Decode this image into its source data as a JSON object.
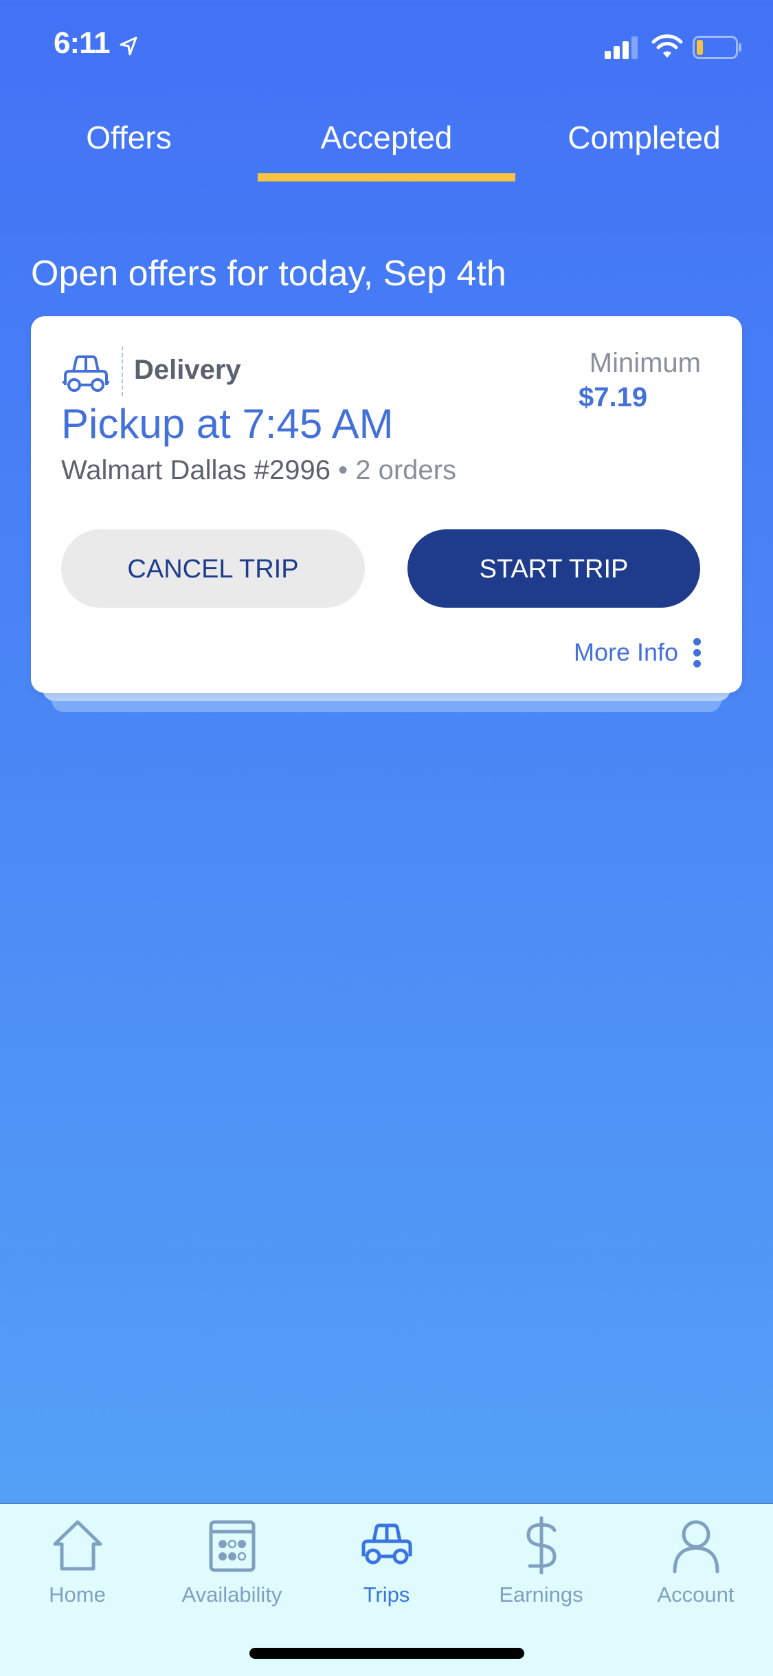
{
  "status_bar": {
    "time": "6:11",
    "icons": [
      "location-arrow-icon",
      "signal-icon",
      "wifi-icon",
      "battery-low-icon"
    ],
    "battery_color": "#F5C242"
  },
  "tabs": [
    {
      "label": "Offers",
      "active": false
    },
    {
      "label": "Accepted",
      "active": true
    },
    {
      "label": "Completed",
      "active": false
    }
  ],
  "section_heading": "Open offers for today, Sep 4th",
  "trip_card": {
    "type_icon": "car-icon",
    "type_label": "Delivery",
    "pickup": "Pickup at 7:45 AM",
    "store": "Walmart Dallas #2996",
    "orders": "• 2 orders",
    "minimum_label": "Minimum",
    "minimum_value": "$7.19",
    "cancel_label": "CANCEL TRIP",
    "start_label": "START TRIP",
    "more_info_label": "More Info"
  },
  "bottom_nav": [
    {
      "label": "Home",
      "icon": "home-icon",
      "active": false
    },
    {
      "label": "Availability",
      "icon": "calendar-icon",
      "active": false
    },
    {
      "label": "Trips",
      "icon": "car-icon",
      "active": true
    },
    {
      "label": "Earnings",
      "icon": "dollar-icon",
      "active": false
    },
    {
      "label": "Account",
      "icon": "person-icon",
      "active": false
    }
  ],
  "colors": {
    "background_top": "#4272F5",
    "background_bottom": "#56A6F7",
    "accent_yellow": "#F5C242",
    "primary_dark": "#1E3C8B",
    "link_blue": "#4471D9",
    "tab_bar_bg": "#E0FBFD"
  }
}
